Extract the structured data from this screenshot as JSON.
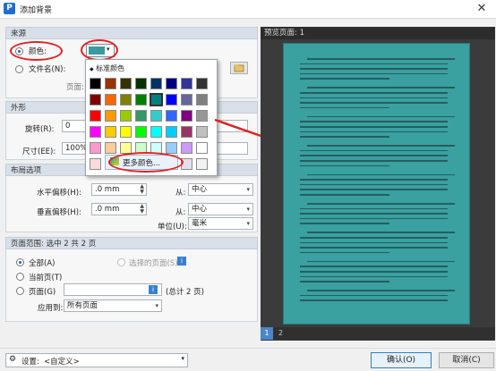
{
  "window": {
    "title": "添加背景",
    "app_icon_letter": "P",
    "close": "✕"
  },
  "source": {
    "section_title": "来源",
    "color_label": "颜色:",
    "color_value": "#3a9aa0",
    "file_label": "文件名(N):",
    "page_label": "页面:",
    "browse_icon": "folder-browse-icon"
  },
  "palette": {
    "header": "标准颜色",
    "more_colors": "更多颜色...",
    "colors": [
      [
        "#000000",
        "#993300",
        "#333300",
        "#003300",
        "#003366",
        "#000080",
        "#333399",
        "#333333"
      ],
      [
        "#800000",
        "#ff6600",
        "#808000",
        "#008000",
        "#008080",
        "#0000ff",
        "#666699",
        "#808080"
      ],
      [
        "#ff0000",
        "#ff9900",
        "#99cc00",
        "#339966",
        "#33cccc",
        "#3366ff",
        "#800080",
        "#969696"
      ],
      [
        "#ff00ff",
        "#ffcc00",
        "#ffff00",
        "#00ff00",
        "#00ffff",
        "#00ccff",
        "#993366",
        "#c0c0c0"
      ],
      [
        "#ff99cc",
        "#ffcc99",
        "#ffff99",
        "#ccffcc",
        "#ccffff",
        "#99ccff",
        "#cc99ff",
        "#ffffff"
      ],
      [
        "#fadadd",
        "#fde9d9",
        "#ffffcc",
        "#e2efda",
        "#dbeef3",
        "#dce6f1",
        "#e4dfec",
        "#f2f2f2"
      ]
    ]
  },
  "appearance": {
    "section_title": "外形",
    "rotation_label": "旋转(R):",
    "rotation_value": "0",
    "size_label": "尺寸(EE):",
    "size_value": "100%"
  },
  "layout": {
    "section_title": "布局选项",
    "h_offset_label": "水平偏移(H):",
    "h_offset_value": ".0 mm",
    "v_offset_label": "垂直偏移(H):",
    "v_offset_value": ".0 mm",
    "from_label": "从:",
    "from_h_value": "中心",
    "from_v_value": "中心",
    "unit_label": "单位(U):",
    "unit_value": "毫米"
  },
  "page_range": {
    "section_title": "页面范围: 选中 2 共 2 页",
    "all_label": "全部(A)",
    "selected_label": "选择的页面(S)",
    "current_label": "当前页(T)",
    "pages_label": "页面(G)",
    "total_label": "(总计 2 页)",
    "apply_label": "应用到:",
    "apply_value": "所有页面"
  },
  "preview": {
    "header": "预览页面: 1",
    "pages": [
      "1",
      "2"
    ]
  },
  "footer": {
    "settings_label": "设置:",
    "settings_value": "<自定义>",
    "ok_label": "确认(O)",
    "cancel_label": "取消(C)"
  },
  "colors": {
    "accent": "#e02222",
    "preview_page": "#3aa0a0"
  }
}
